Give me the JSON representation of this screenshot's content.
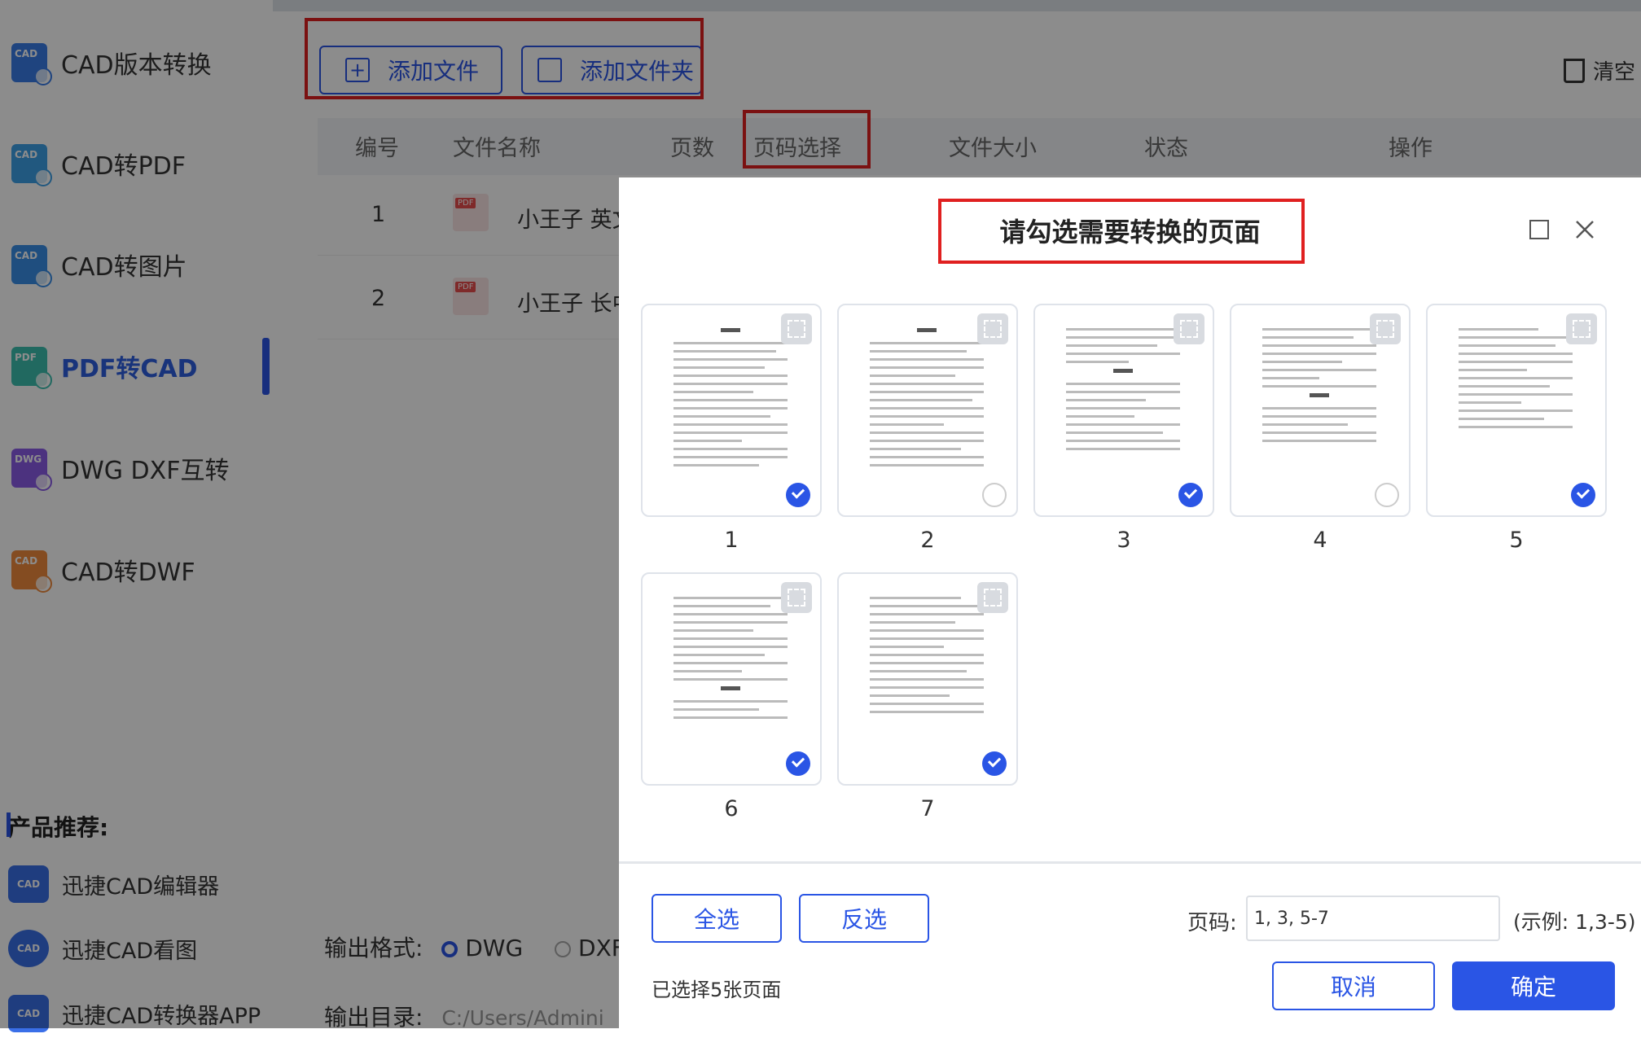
{
  "sidebar": {
    "items": [
      {
        "label": "CAD版本转换",
        "icon": "CAD",
        "color": "#3a7ce8"
      },
      {
        "label": "CAD转PDF",
        "icon": "CAD",
        "color": "#3ca0e8"
      },
      {
        "label": "CAD转图片",
        "icon": "CAD",
        "color": "#3a8ee8"
      },
      {
        "label": "PDF转CAD",
        "icon": "PDF",
        "color": "#3cc0b0"
      },
      {
        "label": "DWG DXF互转",
        "icon": "DWG",
        "color": "#8a5ce8"
      },
      {
        "label": "CAD转DWF",
        "icon": "CAD",
        "color": "#f08a3c"
      }
    ],
    "recommend_title": "产品推荐:",
    "recommend": [
      {
        "label": "迅捷CAD编辑器",
        "icon": "CAD"
      },
      {
        "label": "迅捷CAD看图",
        "icon": "CAD"
      },
      {
        "label": "迅捷CAD转换器APP",
        "icon": "CAD"
      }
    ]
  },
  "toolbar": {
    "add_file": "添加文件",
    "add_folder": "添加文件夹",
    "clear": "清空"
  },
  "table": {
    "headers": [
      "编号",
      "文件名称",
      "页数",
      "页码选择",
      "文件大小",
      "状态",
      "操作"
    ],
    "rows": [
      {
        "index": "1",
        "name": "小王子 英文"
      },
      {
        "index": "2",
        "name": "小王子 长中"
      }
    ]
  },
  "bottom": {
    "format_label": "输出格式:",
    "format_dwg": "DWG",
    "format_dxf": "DXF",
    "output_dir_label": "输出目录:",
    "output_dir_value": "C:/Users/Admini"
  },
  "dialog": {
    "title": "请勾选需要转换的页面",
    "pages": [
      {
        "num": "1",
        "checked": true
      },
      {
        "num": "2",
        "checked": false
      },
      {
        "num": "3",
        "checked": true
      },
      {
        "num": "4",
        "checked": false
      },
      {
        "num": "5",
        "checked": true
      },
      {
        "num": "6",
        "checked": true
      },
      {
        "num": "7",
        "checked": true
      }
    ],
    "select_all": "全选",
    "invert": "反选",
    "page_label": "页码:",
    "page_value": "1, 3, 5-7",
    "example": "(示例: 1,3-5)",
    "selected_count": "已选择5张页面",
    "cancel": "取消",
    "confirm": "确定"
  },
  "colors": {
    "accent": "#2a55e5",
    "highlight": "#e02020"
  }
}
